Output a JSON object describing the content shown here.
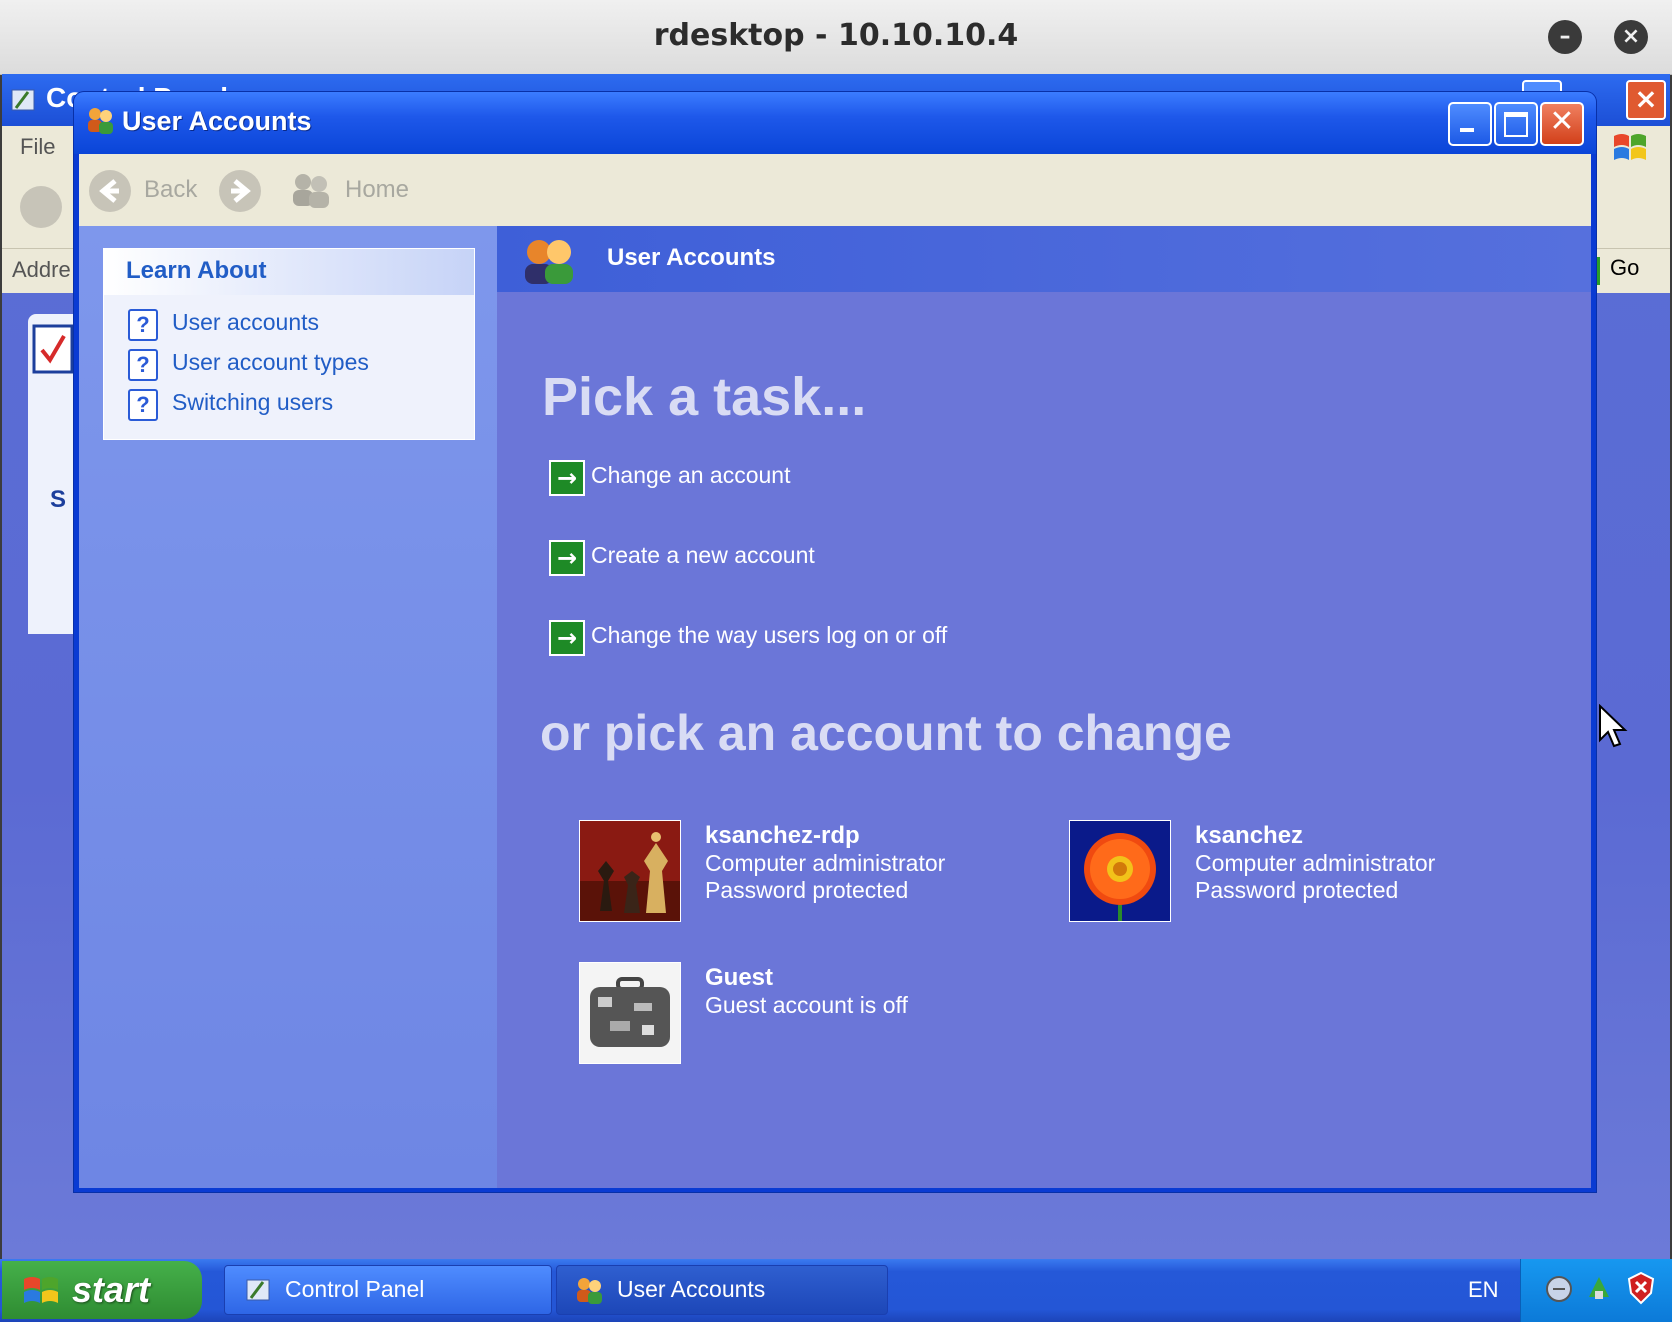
{
  "host": {
    "title": "rdesktop - 10.10.10.4"
  },
  "background_window": {
    "title": "Control Panel",
    "menu_file": "File",
    "address_label": "Addre",
    "go_label": "Go",
    "side_heading": "S"
  },
  "window": {
    "title": "User Accounts",
    "toolbar": {
      "back_label": "Back",
      "home_label": "Home"
    }
  },
  "sidebar": {
    "title": "Learn About",
    "items": [
      {
        "label": "User accounts"
      },
      {
        "label": "User account types"
      },
      {
        "label": "Switching users"
      }
    ]
  },
  "main": {
    "header_title": "User Accounts",
    "pick_task_heading": "Pick a task...",
    "tasks": [
      {
        "label": "Change an account"
      },
      {
        "label": "Create a new account"
      },
      {
        "label": "Change the way users log on or off"
      }
    ],
    "pick_account_heading": "or pick an account to change",
    "accounts": [
      {
        "name": "ksanchez-rdp",
        "lines": [
          "Computer administrator",
          "Password protected"
        ],
        "picture": "chess-pieces"
      },
      {
        "name": "ksanchez",
        "lines": [
          "Computer administrator",
          "Password protected"
        ],
        "picture": "orange-flower"
      },
      {
        "name": "Guest",
        "lines": [
          "Guest account is off"
        ],
        "picture": "suitcase"
      }
    ]
  },
  "taskbar": {
    "start_label": "start",
    "buttons": [
      {
        "label": "Control Panel"
      },
      {
        "label": "User Accounts"
      }
    ],
    "language": "EN"
  },
  "colors": {
    "xp_blue": "#0a45d8",
    "content_bg": "#6b76d8",
    "task_arrow_green": "#1e8a26",
    "start_green": "#3a9e3e"
  }
}
